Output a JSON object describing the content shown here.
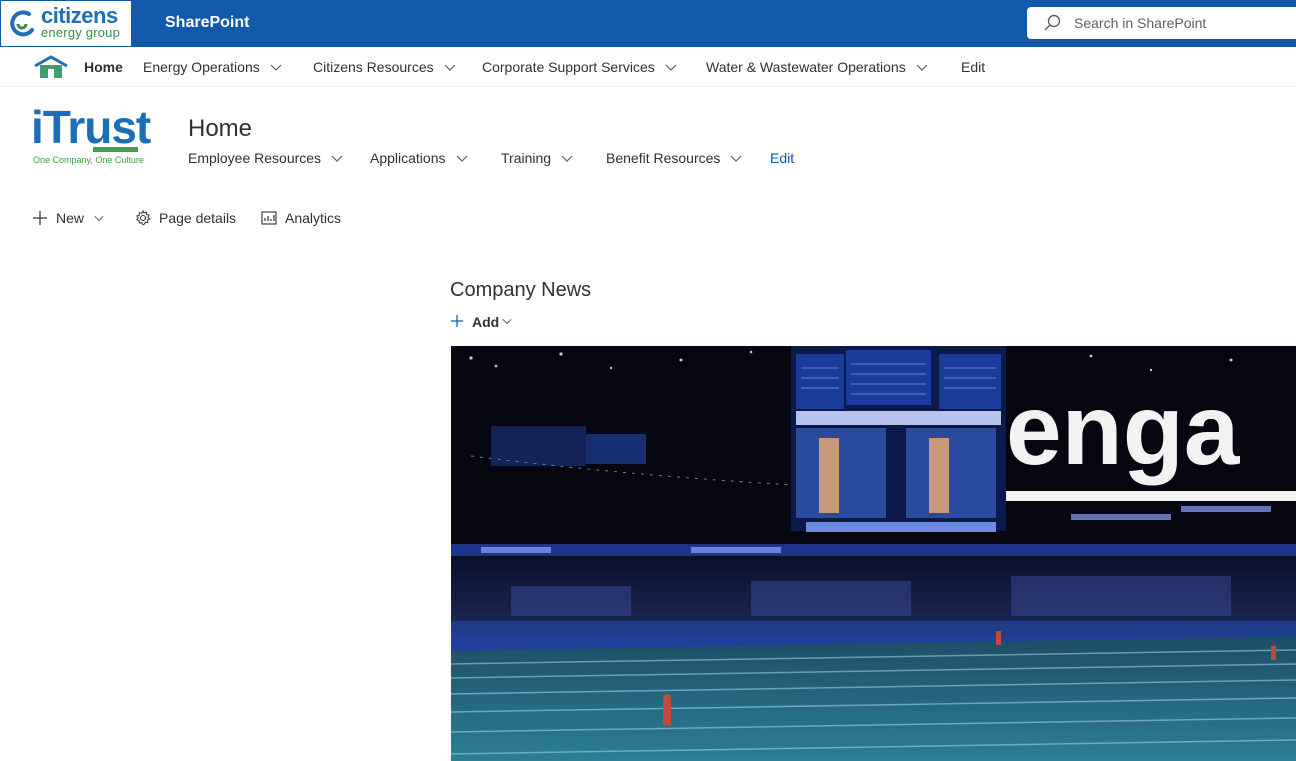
{
  "suite_bar": {
    "brand_name": "citizens",
    "brand_sub": "energy group",
    "app_name": "SharePoint",
    "search_placeholder": "Search in SharePoint"
  },
  "hub_nav": {
    "items": [
      {
        "label": "Home"
      },
      {
        "label": "Energy Operations"
      },
      {
        "label": "Citizens Resources"
      },
      {
        "label": "Corporate Support Services"
      },
      {
        "label": "Water & Wastewater Operations"
      },
      {
        "label": "Edit"
      }
    ]
  },
  "site": {
    "logo_word": "iTrust",
    "logo_tagline": "One Company, One Culture",
    "title": "Home",
    "nav": [
      {
        "label": "Employee Resources"
      },
      {
        "label": "Applications"
      },
      {
        "label": "Training"
      },
      {
        "label": "Benefit Resources"
      },
      {
        "label": "Edit"
      }
    ]
  },
  "command_bar": {
    "new_label": "New",
    "page_details_label": "Page details",
    "analytics_label": "Analytics"
  },
  "news": {
    "title": "Company News",
    "add_label": "Add",
    "hero_text": "enga"
  },
  "colors": {
    "suite_blue": "#1259ab",
    "brand_green": "#3fa246",
    "logo_blue": "#1b6fb8"
  }
}
